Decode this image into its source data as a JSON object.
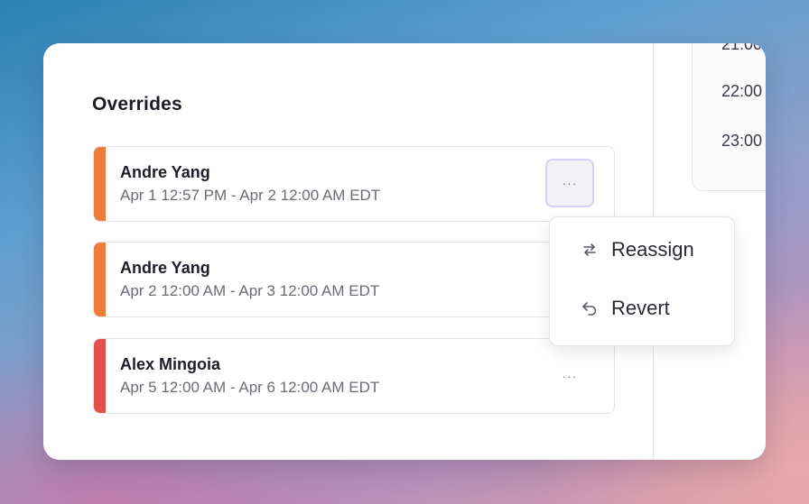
{
  "panel": {
    "title": "Overrides"
  },
  "overrides": [
    {
      "name": "Andre Yang",
      "range": "Apr 1 12:57 PM - Apr 2 12:00 AM EDT",
      "color": "#ee7d3c"
    },
    {
      "name": "Andre Yang",
      "range": "Apr 2 12:00 AM - Apr 3 12:00 AM EDT",
      "color": "#ee7d3c"
    },
    {
      "name": "Alex Mingoia",
      "range": "Apr 5 12:00 AM - Apr 6 12:00 AM EDT",
      "color": "#e2504c"
    }
  ],
  "more_button": {
    "label": "···",
    "icon": "ellipsis-icon"
  },
  "menu": {
    "items": [
      {
        "label": "Reassign",
        "icon": "swap-arrows-icon"
      },
      {
        "label": "Revert",
        "icon": "undo-arrow-icon"
      }
    ]
  },
  "timeline": {
    "times": [
      "21:00",
      "22:00",
      "23:00"
    ]
  }
}
